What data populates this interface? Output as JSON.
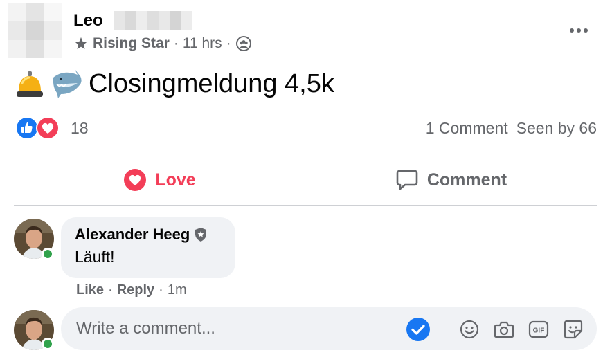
{
  "post": {
    "author_name": "Leo",
    "author_badge": "Rising Star",
    "time": "11 hrs",
    "separator": "·",
    "audience_icon": "group-icon",
    "text": "Closingmeldung 4,5k",
    "emojis": [
      "bell-emoji",
      "shark-emoji"
    ]
  },
  "reactions": {
    "icons": [
      "like-reaction-icon",
      "love-reaction-icon"
    ],
    "count": "18",
    "comments": "1 Comment",
    "seen": "Seen by 66"
  },
  "actions": {
    "love_label": "Love",
    "comment_label": "Comment"
  },
  "comment": {
    "author": "Alexander Heeg",
    "author_badge_icon": "shield-badge-icon",
    "text": "Läuft!",
    "like_label": "Like",
    "reply_label": "Reply",
    "dot": "·",
    "time": "1m"
  },
  "composer": {
    "placeholder": "Write a comment...",
    "tools": [
      "emoji-icon",
      "camera-icon",
      "gif-icon",
      "sticker-icon"
    ]
  },
  "colors": {
    "love": "#f33e58",
    "like": "#1877f2",
    "online": "#31a24c",
    "muted": "#65676b",
    "bubble": "#f0f2f5"
  }
}
